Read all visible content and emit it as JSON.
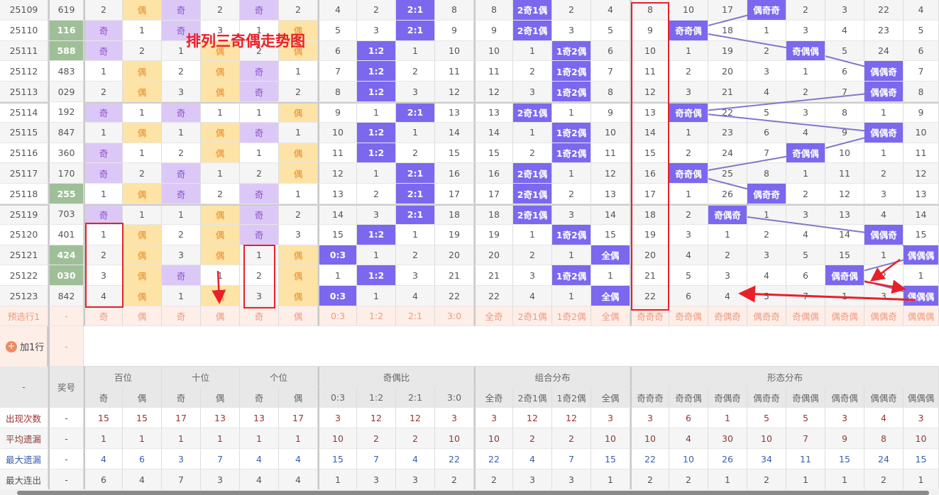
{
  "title": "排列三奇偶走势图",
  "rows": [
    {
      "period": "25109",
      "number": "619",
      "hl": false,
      "v": [
        "2",
        "偶",
        "奇",
        "2",
        "奇",
        "2",
        "4",
        "2",
        "2:1",
        "8",
        "8",
        "2奇1偶",
        "2",
        "4",
        "8",
        "10",
        "17",
        "偶奇奇",
        "2",
        "3",
        "22",
        "4"
      ]
    },
    {
      "period": "25110",
      "number": "116",
      "hl": true,
      "v": [
        "奇",
        "1",
        "奇",
        "3",
        "1",
        "偶",
        "5",
        "3",
        "2:1",
        "9",
        "9",
        "2奇1偶",
        "3",
        "5",
        "9",
        "奇奇偶",
        "18",
        "1",
        "3",
        "4",
        "23",
        "5"
      ]
    },
    {
      "period": "25111",
      "number": "588",
      "hl": true,
      "v": [
        "奇",
        "2",
        "1",
        "偶",
        "2",
        "偶",
        "6",
        "1:2",
        "1",
        "10",
        "10",
        "1",
        "1奇2偶",
        "6",
        "10",
        "1",
        "19",
        "2",
        "奇偶偶",
        "5",
        "24",
        "6"
      ]
    },
    {
      "period": "25112",
      "number": "483",
      "hl": false,
      "v": [
        "1",
        "偶",
        "2",
        "偶",
        "奇",
        "1",
        "7",
        "1:2",
        "2",
        "11",
        "11",
        "2",
        "1奇2偶",
        "7",
        "11",
        "2",
        "20",
        "3",
        "1",
        "6",
        "偶偶奇",
        "7"
      ]
    },
    {
      "period": "25113",
      "number": "029",
      "hl": false,
      "v": [
        "2",
        "偶",
        "3",
        "偶",
        "奇",
        "2",
        "8",
        "1:2",
        "3",
        "12",
        "12",
        "3",
        "1奇2偶",
        "8",
        "12",
        "3",
        "21",
        "4",
        "2",
        "7",
        "偶偶奇",
        "8"
      ]
    },
    {
      "period": "25114",
      "number": "192",
      "hl": false,
      "v": [
        "奇",
        "1",
        "奇",
        "1",
        "1",
        "偶",
        "9",
        "1",
        "2:1",
        "13",
        "13",
        "2奇1偶",
        "1",
        "9",
        "13",
        "奇奇偶",
        "22",
        "5",
        "3",
        "8",
        "1",
        "9"
      ]
    },
    {
      "period": "25115",
      "number": "847",
      "hl": false,
      "v": [
        "1",
        "偶",
        "1",
        "偶",
        "奇",
        "1",
        "10",
        "1:2",
        "1",
        "14",
        "14",
        "1",
        "1奇2偶",
        "10",
        "14",
        "1",
        "23",
        "6",
        "4",
        "9",
        "偶偶奇",
        "10"
      ]
    },
    {
      "period": "25116",
      "number": "360",
      "hl": false,
      "v": [
        "奇",
        "1",
        "2",
        "偶",
        "1",
        "偶",
        "11",
        "1:2",
        "2",
        "15",
        "15",
        "2",
        "1奇2偶",
        "11",
        "15",
        "2",
        "24",
        "7",
        "奇偶偶",
        "10",
        "1",
        "11"
      ]
    },
    {
      "period": "25117",
      "number": "170",
      "hl": false,
      "v": [
        "奇",
        "2",
        "奇",
        "1",
        "2",
        "偶",
        "12",
        "1",
        "2:1",
        "16",
        "16",
        "2奇1偶",
        "1",
        "12",
        "16",
        "奇奇偶",
        "25",
        "8",
        "1",
        "11",
        "2",
        "12"
      ]
    },
    {
      "period": "25118",
      "number": "255",
      "hl": true,
      "v": [
        "1",
        "偶",
        "奇",
        "2",
        "奇",
        "1",
        "13",
        "2",
        "2:1",
        "17",
        "17",
        "2奇1偶",
        "2",
        "13",
        "17",
        "1",
        "26",
        "偶奇奇",
        "2",
        "12",
        "3",
        "13"
      ]
    },
    {
      "period": "25119",
      "number": "703",
      "hl": false,
      "v": [
        "奇",
        "1",
        "1",
        "偶",
        "奇",
        "2",
        "14",
        "3",
        "2:1",
        "18",
        "18",
        "2奇1偶",
        "3",
        "14",
        "18",
        "2",
        "奇偶奇",
        "1",
        "3",
        "13",
        "4",
        "14"
      ]
    },
    {
      "period": "25120",
      "number": "401",
      "hl": false,
      "v": [
        "1",
        "偶",
        "2",
        "偶",
        "奇",
        "3",
        "15",
        "1:2",
        "1",
        "19",
        "19",
        "1",
        "1奇2偶",
        "15",
        "19",
        "3",
        "1",
        "2",
        "4",
        "14",
        "偶偶奇",
        "15"
      ]
    },
    {
      "period": "25121",
      "number": "424",
      "hl": true,
      "v": [
        "2",
        "偶",
        "3",
        "偶",
        "1",
        "偶",
        "0:3",
        "1",
        "2",
        "20",
        "20",
        "2",
        "1",
        "全偶",
        "20",
        "4",
        "2",
        "3",
        "5",
        "15",
        "1",
        "偶偶偶"
      ]
    },
    {
      "period": "25122",
      "number": "030",
      "hl": true,
      "v": [
        "3",
        "偶",
        "奇",
        "1",
        "2",
        "偶",
        "1",
        "1:2",
        "3",
        "21",
        "21",
        "3",
        "1奇2偶",
        "1",
        "21",
        "5",
        "3",
        "4",
        "6",
        "偶奇偶",
        "2",
        "1"
      ]
    },
    {
      "period": "25123",
      "number": "842",
      "hl": false,
      "v": [
        "4",
        "偶",
        "1",
        "偶",
        "3",
        "偶",
        "0:3",
        "1",
        "4",
        "22",
        "22",
        "4",
        "1",
        "全偶",
        "22",
        "6",
        "4",
        "5",
        "7",
        "1",
        "3",
        "偶偶偶"
      ]
    }
  ],
  "preview": {
    "label": "预选行1",
    "number": "-",
    "v": [
      "奇",
      "偶",
      "奇",
      "偶",
      "奇",
      "偶",
      "0:3",
      "1:2",
      "2:1",
      "3:0",
      "全奇",
      "2奇1偶",
      "1奇2偶",
      "全偶",
      "奇奇奇",
      "奇奇偶",
      "奇偶奇",
      "偶奇奇",
      "奇偶偶",
      "偶奇偶",
      "偶偶奇",
      "偶偶偶"
    ]
  },
  "add_row": {
    "label": "加1行",
    "number": "-"
  },
  "header": {
    "corner": "-",
    "number": "奖号",
    "groups": [
      "百位",
      "十位",
      "个位",
      "奇偶比",
      "组合分布",
      "形态分布"
    ],
    "sub": [
      "奇",
      "偶",
      "奇",
      "偶",
      "奇",
      "偶",
      "0:3",
      "1:2",
      "2:1",
      "3:0",
      "全奇",
      "2奇1偶",
      "1奇2偶",
      "全偶",
      "奇奇奇",
      "奇奇偶",
      "奇偶奇",
      "偶奇奇",
      "奇偶偶",
      "偶奇偶",
      "偶偶奇",
      "偶偶偶"
    ]
  },
  "stats": [
    {
      "label": "出现次数",
      "number": "-",
      "color": "#a0302f",
      "v": [
        "15",
        "15",
        "17",
        "13",
        "13",
        "17",
        "3",
        "12",
        "12",
        "3",
        "3",
        "12",
        "12",
        "3",
        "3",
        "6",
        "1",
        "5",
        "5",
        "3",
        "4",
        "3"
      ]
    },
    {
      "label": "平均遗漏",
      "number": "-",
      "color": "#8b3a3a",
      "v": [
        "1",
        "1",
        "1",
        "1",
        "1",
        "1",
        "10",
        "2",
        "2",
        "10",
        "10",
        "2",
        "2",
        "10",
        "10",
        "4",
        "30",
        "10",
        "7",
        "9",
        "8",
        "10"
      ]
    },
    {
      "label": "最大遗漏",
      "number": "-",
      "color": "#3a5fb0",
      "v": [
        "4",
        "6",
        "3",
        "7",
        "4",
        "4",
        "15",
        "7",
        "4",
        "22",
        "22",
        "4",
        "7",
        "15",
        "22",
        "10",
        "26",
        "34",
        "11",
        "15",
        "24",
        "15"
      ]
    },
    {
      "label": "最大连出",
      "number": "-",
      "color": "#555555",
      "v": [
        "6",
        "4",
        "7",
        "3",
        "4",
        "4",
        "1",
        "3",
        "3",
        "2",
        "2",
        "3",
        "3",
        "1",
        "2",
        "2",
        "1",
        "2",
        "1",
        "1",
        "2",
        "1"
      ]
    }
  ]
}
